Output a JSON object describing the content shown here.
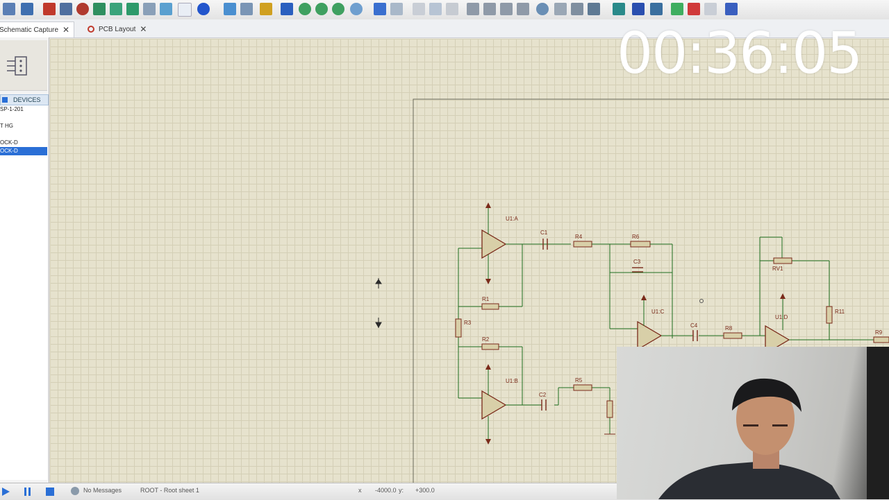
{
  "tabs": [
    {
      "label": "Schematic Capture",
      "active": true
    },
    {
      "label": "PCB Layout",
      "active": false
    }
  ],
  "left_panel": {
    "devices_header": "DEVICES",
    "devices": [
      "SP-1-201",
      "",
      "T HG",
      "",
      "OCK-D",
      "OCK-D"
    ],
    "selected_index": 5
  },
  "timer": "00:36:05",
  "statusbar": {
    "messages": "No Messages",
    "sheet": "ROOT - Root sheet 1",
    "x": "-4000.0",
    "y_label": "y:",
    "y": "+300.0"
  },
  "schematic": {
    "labels": {
      "u1a": "U1:A",
      "u1b": "U1:B",
      "u1c": "U1:C",
      "u1d": "U1:D",
      "c1": "C1",
      "c2": "C2",
      "c3": "C3",
      "c4": "C4",
      "r1": "R1",
      "r2": "R2",
      "r3": "R3",
      "r4": "R4",
      "r5": "R5",
      "r6": "R6",
      "r8": "R8",
      "r9": "R9",
      "r11": "R11",
      "rv1": "RV1"
    }
  },
  "colors": {
    "canvas": "#e6e2cd",
    "grid": "#d4cfb6",
    "wire": "#1f6f1f",
    "component": "#7a2a1a",
    "selection": "#2a6fd6"
  }
}
